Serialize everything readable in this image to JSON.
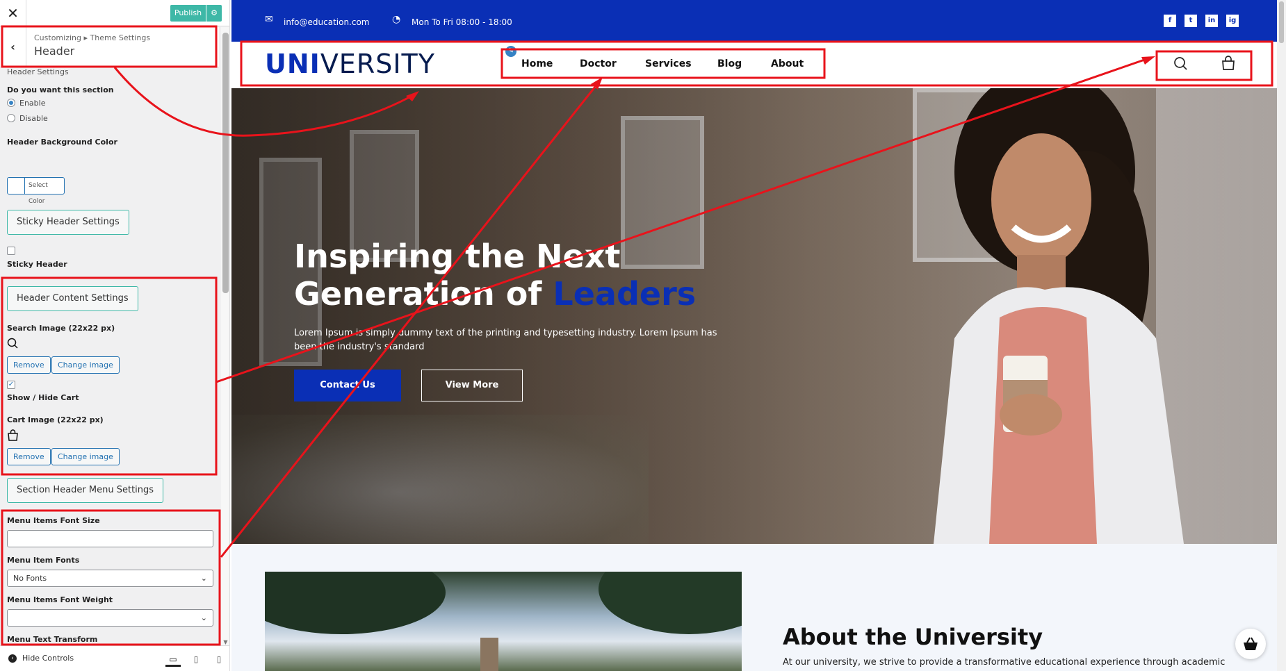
{
  "customizer": {
    "close_icon": "close-icon",
    "publish_label": "Publish",
    "gear_icon": "gear-icon",
    "breadcrumb": "Customizing ▸ Theme Settings",
    "panel_title": "Header",
    "header_settings": "Header Settings",
    "section_question": "Do you want this section",
    "enable_label": "Enable",
    "disable_label": "Disable",
    "bg_color_label": "Header Background Color",
    "select_color": "Select Color",
    "sticky_settings_btn": "Sticky Header Settings",
    "sticky_header_label": "Sticky Header",
    "content_settings_btn": "Header Content Settings",
    "search_image_label": "Search Image (22x22 px)",
    "remove_label": "Remove",
    "change_image_label": "Change image",
    "show_hide_cart_label": "Show / Hide Cart",
    "cart_image_label": "Cart Image (22x22 px)",
    "menu_settings_btn": "Section Header Menu Settings",
    "menu_font_size_label": "Menu Items Font Size",
    "menu_fonts_label": "Menu Item Fonts",
    "menu_fonts_value": "No Fonts",
    "menu_weight_label": "Menu Items Font Weight",
    "menu_weight_value": "",
    "menu_transform_label": "Menu Text Transform",
    "hide_controls": "Hide Controls"
  },
  "site": {
    "email": "info@education.com",
    "hours": "Mon To Fri 08:00 - 18:00",
    "social": [
      "f",
      "t",
      "in",
      "ig"
    ],
    "logo_bold": "UNI",
    "logo_rest": "VERSITY",
    "nav": [
      "Home",
      "Doctor",
      "Services",
      "Blog",
      "About"
    ],
    "hero": {
      "title_line1": "Inspiring the Next",
      "title_line2": "Generation of",
      "title_accent": "Leaders",
      "description": "Lorem Ipsum is simply dummy text of the printing and typesetting industry. Lorem Ipsum has been the industry's standard",
      "contact_btn": "Contact Us",
      "more_btn": "View More"
    },
    "about": {
      "title": "About the University",
      "text": "At our university, we strive to provide a transformative educational experience through academic"
    }
  },
  "colors": {
    "brand_blue": "#0a2fb5",
    "publish_green": "#3eb8a7",
    "annotation_red": "#e8131b"
  }
}
